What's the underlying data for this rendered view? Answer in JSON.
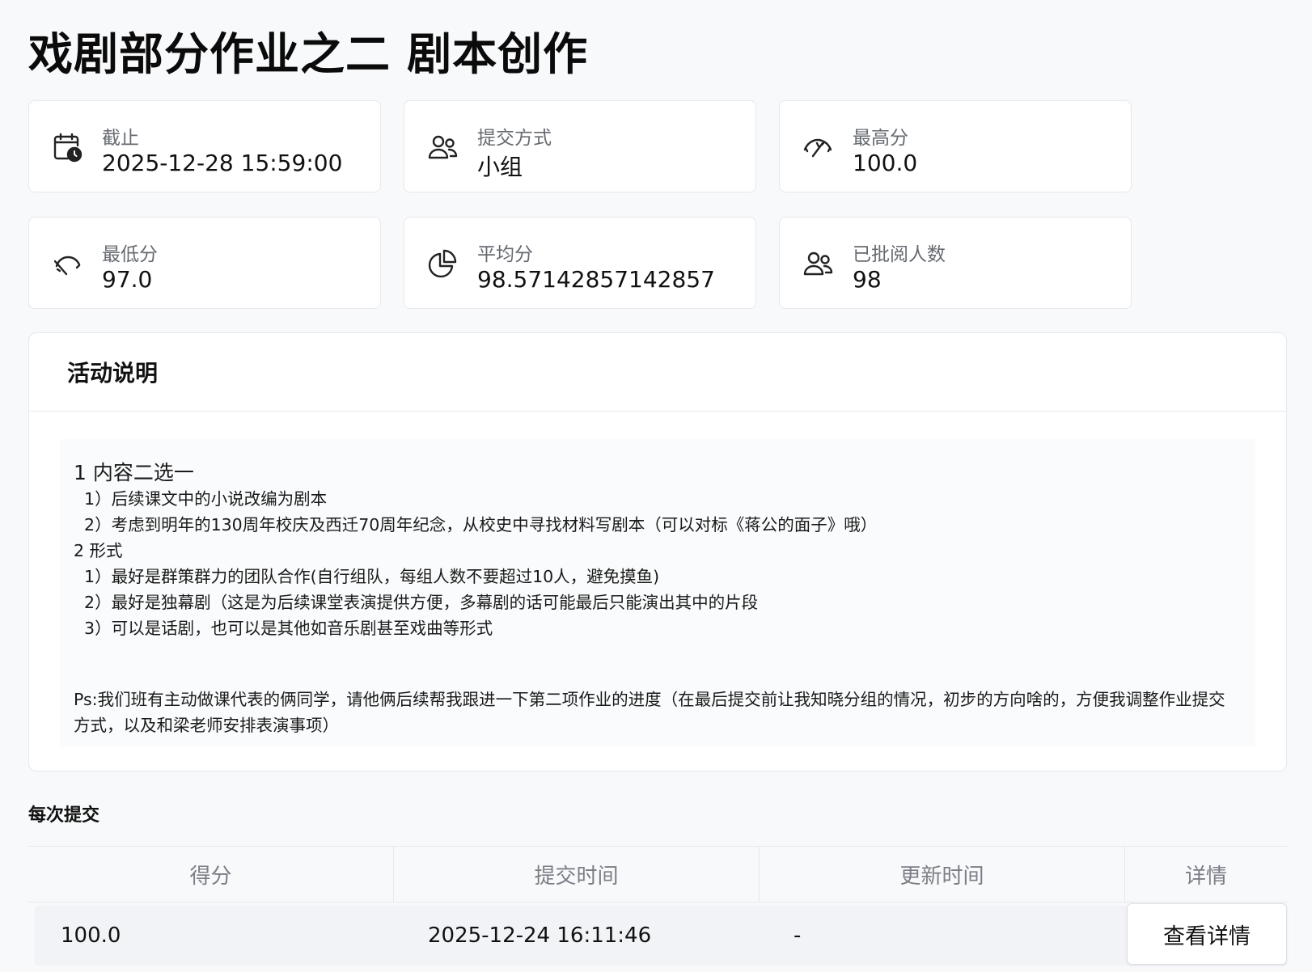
{
  "page": {
    "title": "戏剧部分作业之二 剧本创作"
  },
  "stats": [
    {
      "icon": "calendar-clock-icon",
      "label": "截止",
      "value": "2025-12-28 15:59:00"
    },
    {
      "icon": "group-users-icon",
      "label": "提交方式",
      "value": "小组"
    },
    {
      "icon": "gauge-high-icon",
      "label": "最高分",
      "value": "100.0"
    },
    {
      "icon": "gauge-low-icon",
      "label": "最低分",
      "value": "97.0"
    },
    {
      "icon": "pie-chart-icon",
      "label": "平均分",
      "value": "98.57142857142857"
    },
    {
      "icon": "group-users-icon",
      "label": "已批阅人数",
      "value": "98"
    }
  ],
  "description": {
    "title": "活动说明",
    "lines": [
      "1 内容二选一",
      "  1）后续课文中的小说改编为剧本",
      "  2）考虑到明年的130周年校庆及西迁70周年纪念，从校史中寻找材料写剧本（可以对标《蒋公的面子》哦）",
      "2 形式",
      "  1）最好是群策群力的团队合作(自行组队，每组人数不要超过10人，避免摸鱼)",
      "  2）最好是独幕剧（这是为后续课堂表演提供方便，多幕剧的话可能最后只能演出其中的片段",
      "  3）可以是话剧，也可以是其他如音乐剧甚至戏曲等形式"
    ],
    "ps": "Ps:我们班有主动做课代表的俩同学，请他俩后续帮我跟进一下第二项作业的进度（在最后提交前让我知晓分组的情况，初步的方向啥的，方便我调整作业提交方式，以及和梁老师安排表演事项）"
  },
  "submissions": {
    "title": "每次提交",
    "columns": [
      "得分",
      "提交时间",
      "更新时间",
      "详情"
    ],
    "rows": [
      {
        "score": "100.0",
        "submitted": "2025-12-24 16:11:46",
        "updated": "-",
        "action": "查看详情"
      }
    ]
  }
}
